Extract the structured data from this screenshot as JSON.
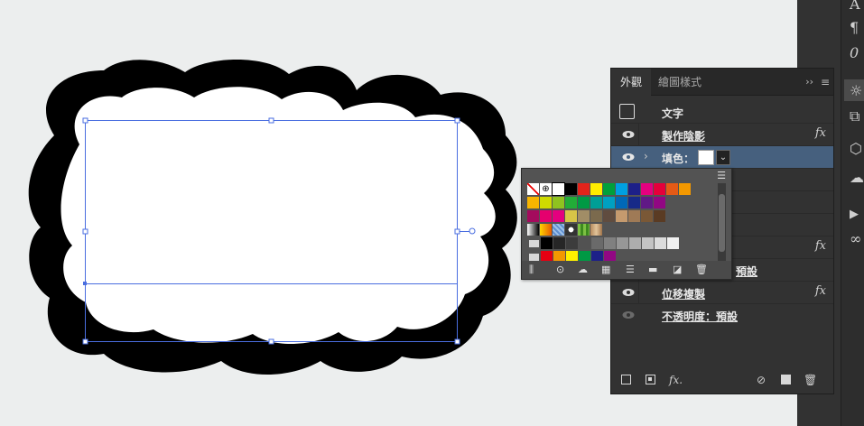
{
  "panel": {
    "tabs": [
      {
        "label": "外觀",
        "active": true
      },
      {
        "label": "繪圖樣式",
        "active": false
      }
    ],
    "tab_more": "››",
    "tab_menu": "≡",
    "rows": [
      {
        "label": "文字"
      },
      {
        "label": "製作陰影",
        "fx": "fx"
      },
      {
        "label": "填色：",
        "selected": true
      },
      {
        "label": "預設",
        "partial": true
      },
      {
        "label": "位移複製",
        "fx": "fx"
      },
      {
        "label": "不透明度：預設"
      }
    ],
    "row_hidden_fx": "fx",
    "bottom_fx": "fx."
  },
  "flyout": {
    "swatch_rows": [
      [
        "none",
        "registration",
        "#ffffff",
        "#000000",
        "#e3231b",
        "#ffec00",
        "#00a03b",
        "#00a0e1",
        "#1d2088",
        "#e4007f",
        "#e5003b",
        "#e55a16",
        "#f39800"
      ],
      [
        "#f8b500",
        "#cfdb00",
        "#8fc31f",
        "#22ac38",
        "#009944",
        "#009e96",
        "#00a0c1",
        "#0068b7",
        "#172a88",
        "#601986",
        "#920783"
      ],
      [
        "#a40b5d",
        "#e5006e",
        "#e4007f",
        "#d7c447",
        "#a18d66",
        "#7b6a4d",
        "#604c3f",
        "#c59a6e",
        "#9f7a56",
        "#7a5836",
        "#5a3b23"
      ],
      [
        "gradient-bw",
        "gradient-orange",
        "pattern-blue",
        "pattern-dots",
        "pattern-green",
        "pattern-wood"
      ],
      [
        "#000000",
        "#262626",
        "#3c3c3c",
        "#525252",
        "#6a6a6a",
        "#808080",
        "#979797",
        "#adadad",
        "#c4c4c4",
        "#dcdcdc",
        "#f1f1f1"
      ],
      [
        "#e60012",
        "#f39800",
        "#fff100",
        "#009944",
        "#1d2088",
        "#920783"
      ]
    ],
    "tool_icons": [
      "library-icon",
      "swatch-kind-icon",
      "cloud-icon",
      "grid-view-icon",
      "list-view-icon",
      "new-folder-icon",
      "new-swatch-icon",
      "delete-icon"
    ]
  },
  "toolstrip": {
    "glyphs": [
      "A",
      "¶",
      "0",
      "☼",
      "⧉",
      "⬡",
      "☁",
      "▶",
      "∞"
    ]
  }
}
